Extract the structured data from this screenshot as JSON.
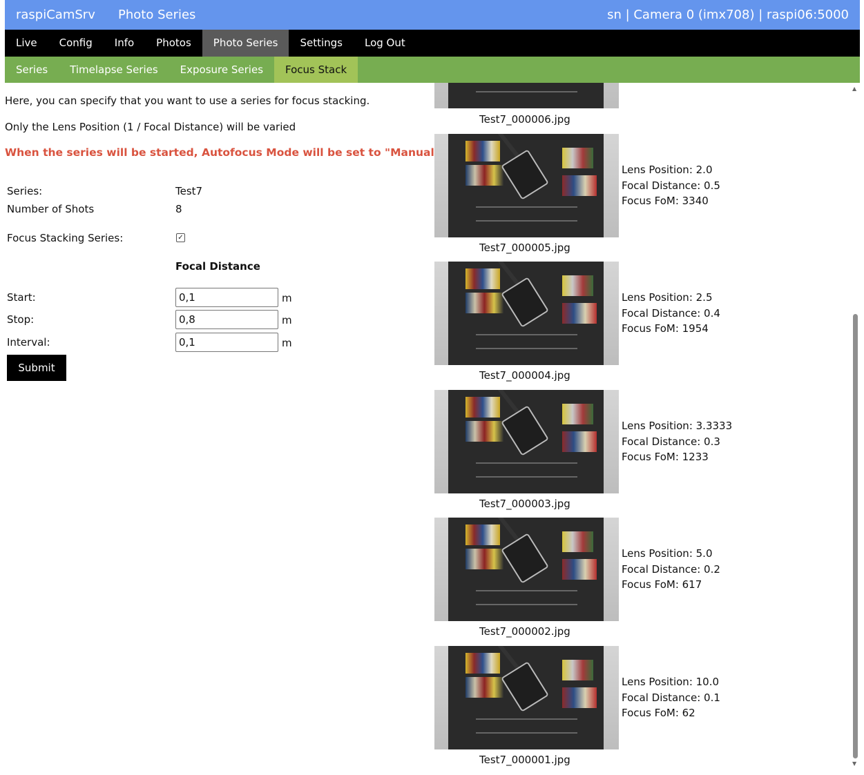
{
  "header": {
    "app_name": "raspiCamSrv",
    "page_title": "Photo Series",
    "status": "sn | Camera 0 (imx708) | raspi06:5000",
    "color": "#6495ed"
  },
  "main_nav": {
    "items": [
      {
        "label": "Live"
      },
      {
        "label": "Config"
      },
      {
        "label": "Info"
      },
      {
        "label": "Photos"
      },
      {
        "label": "Photo Series",
        "active": true
      },
      {
        "label": "Settings"
      },
      {
        "label": "Log Out"
      }
    ]
  },
  "sub_nav": {
    "color": "#77ad51",
    "items": [
      {
        "label": "Series"
      },
      {
        "label": "Timelapse Series"
      },
      {
        "label": "Exposure Series"
      },
      {
        "label": "Focus Stack",
        "active": true
      }
    ]
  },
  "form": {
    "intro1": "Here, you can specify that you want to use a series for focus stacking.",
    "intro2": "Only the Lens Position (1 / Focal Distance) will be varied",
    "warning": "When the series will be started, Autofocus Mode will be set to \"Manual\".",
    "series_label": "Series:",
    "series_value": "Test7",
    "shots_label": "Number of Shots",
    "shots_value": "8",
    "focus_stack_label": "Focus Stacking Series:",
    "focus_stack_checked": true,
    "section_title": "Focal Distance",
    "start_label": "Start:",
    "start_value": "0,1",
    "stop_label": "Stop:",
    "stop_value": "0,8",
    "interval_label": "Interval:",
    "interval_value": "0,1",
    "unit": "m",
    "submit_label": "Submit"
  },
  "photos": [
    {
      "filename": "Test7_000006.jpg"
    },
    {
      "filename": "Test7_000005.jpg",
      "lens": "Lens Position: 2.0",
      "focal": "Focal Distance: 0.5",
      "fom": "Focus FoM: 3340"
    },
    {
      "filename": "Test7_000004.jpg",
      "lens": "Lens Position: 2.5",
      "focal": "Focal Distance: 0.4",
      "fom": "Focus FoM: 1954"
    },
    {
      "filename": "Test7_000003.jpg",
      "lens": "Lens Position: 3.3333",
      "focal": "Focal Distance: 0.3",
      "fom": "Focus FoM: 1233"
    },
    {
      "filename": "Test7_000002.jpg",
      "lens": "Lens Position: 5.0",
      "focal": "Focal Distance: 0.2",
      "fom": "Focus FoM: 617"
    },
    {
      "filename": "Test7_000001.jpg",
      "lens": "Lens Position: 10.0",
      "focal": "Focal Distance: 0.1",
      "fom": "Focus FoM: 62"
    }
  ]
}
